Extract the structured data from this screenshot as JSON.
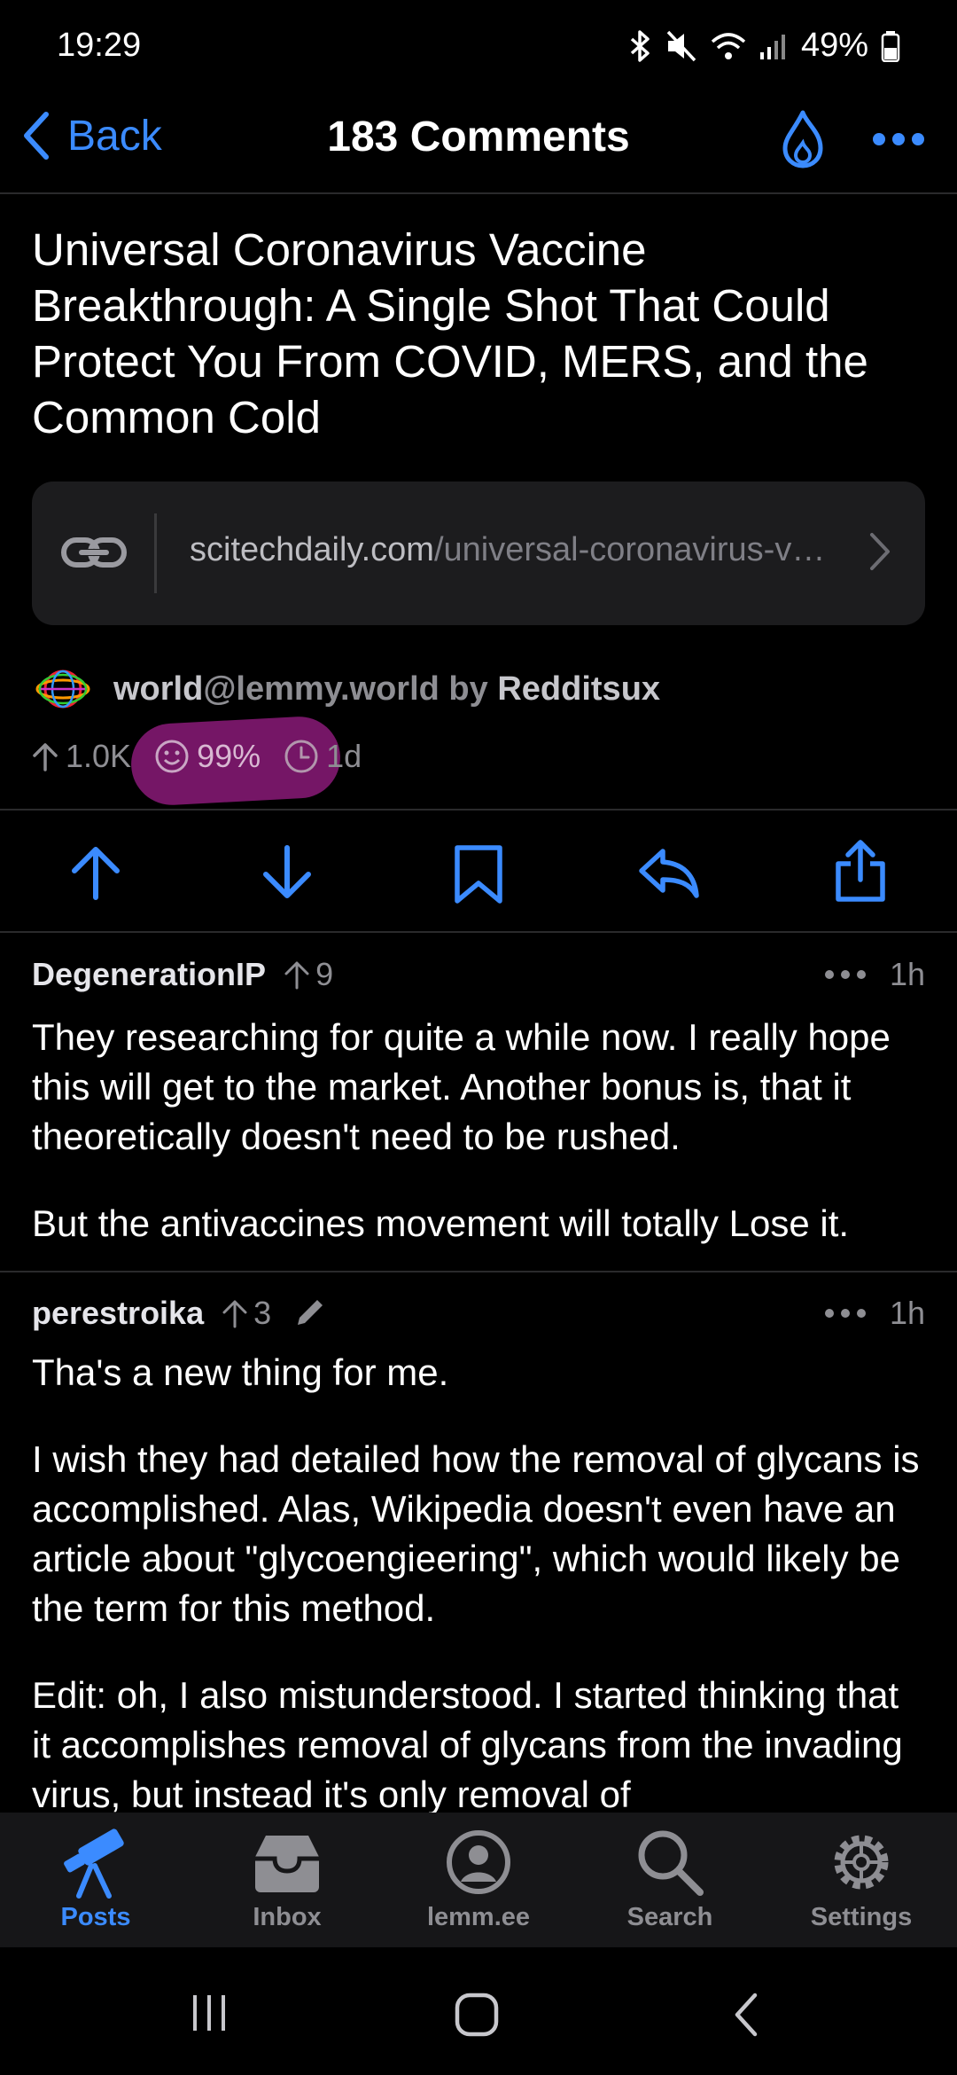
{
  "status_bar": {
    "time": "19:29",
    "battery": "49%"
  },
  "nav": {
    "back_label": "Back",
    "title": "183 Comments"
  },
  "post": {
    "title": "Universal Coronavirus Vaccine Breakthrough: A Single Shot That Could Protect You From COVID, MERS, and the Common Cold",
    "link_domain": "scitechdaily.com",
    "link_path": "/universal-coronavirus-v…",
    "community": "world",
    "instance": "@lemmy.world",
    "by_label": "by",
    "author": "Redditsux",
    "score": "1.0K",
    "upvote_ratio": "99%",
    "age": "1d"
  },
  "comments": [
    {
      "author": "DegenerationIP",
      "votes": "9",
      "age": "1h",
      "paragraphs": [
        "They researching for quite a while now. I really hope this will get to the market. Another bonus is, that it theoretically doesn't need to be rushed.",
        "But the antivaccines movement will totally Lose it."
      ]
    },
    {
      "author": "perestroika",
      "votes": "3",
      "age": "1h",
      "paragraphs": [
        "Tha's a new thing for me.",
        "I wish they had detailed how the removal of glycans is accomplished. Alas, Wikipedia doesn't even have an article about \"glycoengieering\", which would likely be the term for this method.",
        "Edit: oh, I also mistunderstood. I started thinking that it accomplishes removal of glycans from the invading virus, but instead it's only removal of"
      ]
    }
  ],
  "tab_bar": {
    "tabs": [
      {
        "label": "Posts",
        "icon": "telescope-icon",
        "active": true
      },
      {
        "label": "Inbox",
        "icon": "inbox-tray-icon",
        "active": false
      },
      {
        "label": "lemm.ee",
        "icon": "profile-icon",
        "active": false
      },
      {
        "label": "Search",
        "icon": "search-icon",
        "active": false
      },
      {
        "label": "Settings",
        "icon": "gear-icon",
        "active": false
      }
    ]
  },
  "colors": {
    "accent": "#3b8bff",
    "background": "#000000",
    "highlight": "#8a1a78"
  }
}
